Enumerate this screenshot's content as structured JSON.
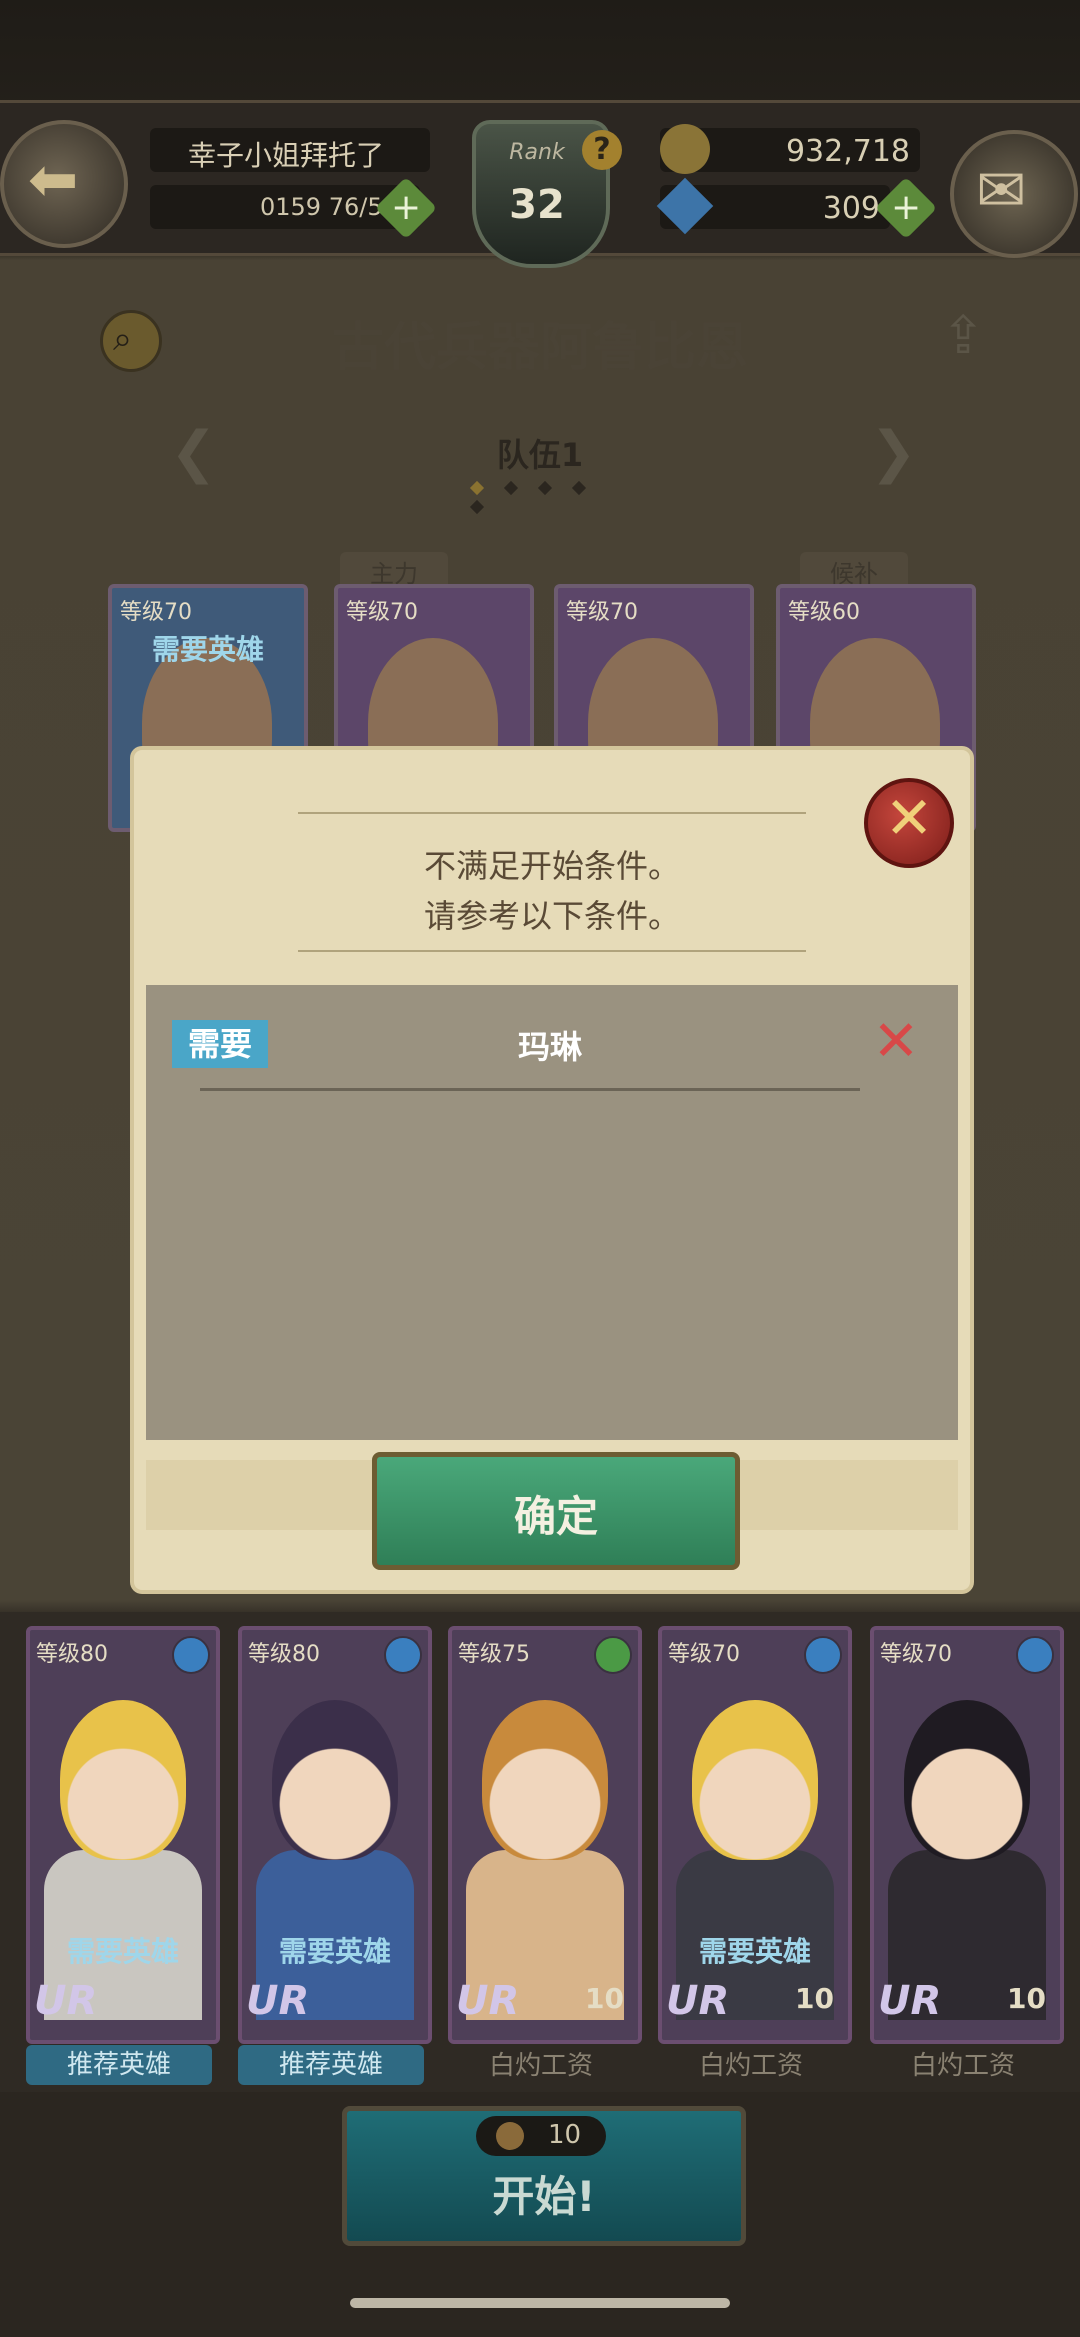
{
  "hud": {
    "player_name": "幸子小姐拜托了",
    "stamina": "0159 76/51",
    "rank_label": "Rank",
    "rank_value": "32",
    "gold": "932,718",
    "gems": "309"
  },
  "stage": {
    "title": "古代兵器阿鲁比恩",
    "team_label": "队伍1",
    "team_pages": 5,
    "active_page": 1,
    "slot_main": "主力",
    "slot_reserve": "候补"
  },
  "team_cards": [
    {
      "level": "等级70",
      "note": "需要英雄",
      "tint": "#3f5a79"
    },
    {
      "level": "等级70",
      "note": "",
      "tint": "#5c4669"
    },
    {
      "level": "等级70",
      "note": "",
      "tint": "#5c4669"
    },
    {
      "level": "等级60",
      "note": "",
      "tint": "#5c4669"
    }
  ],
  "dialog": {
    "line1": "不满足开始条件。",
    "line2": "请参考以下条件。",
    "condition_tag": "需要",
    "condition_name": "玛琳",
    "confirm_label": "确定"
  },
  "heroes": [
    {
      "level": "等级80",
      "need": "需要英雄",
      "cost": "",
      "label": "推荐英雄",
      "recommended": true,
      "hair": "#e8c24a",
      "outfit": "#c9c6c0",
      "elem": "#3a7fbf"
    },
    {
      "level": "等级80",
      "need": "需要英雄",
      "cost": "",
      "label": "推荐英雄",
      "recommended": true,
      "hair": "#3b2f4a",
      "outfit": "#3c5f9a",
      "elem": "#3a7fbf"
    },
    {
      "level": "等级75",
      "need": "",
      "cost": "10",
      "label": "白灼工资",
      "recommended": false,
      "hair": "#c88a3c",
      "outfit": "#d8b48a",
      "elem": "#4b9a45"
    },
    {
      "level": "等级70",
      "need": "需要英雄",
      "cost": "10",
      "label": "白灼工资",
      "recommended": false,
      "hair": "#e8c24a",
      "outfit": "#3a3a44",
      "elem": "#3a7fbf"
    },
    {
      "level": "等级70",
      "need": "",
      "cost": "10",
      "label": "白灼工资",
      "recommended": false,
      "hair": "#1f1b22",
      "outfit": "#2e2a30",
      "elem": "#3a7fbf"
    }
  ],
  "start": {
    "cost": "10",
    "label": "开始!"
  },
  "colors": {
    "confirm": "#3a9669",
    "close": "#a8322b",
    "condition_tag": "#4aa6c8",
    "unmet": "#d84848"
  }
}
